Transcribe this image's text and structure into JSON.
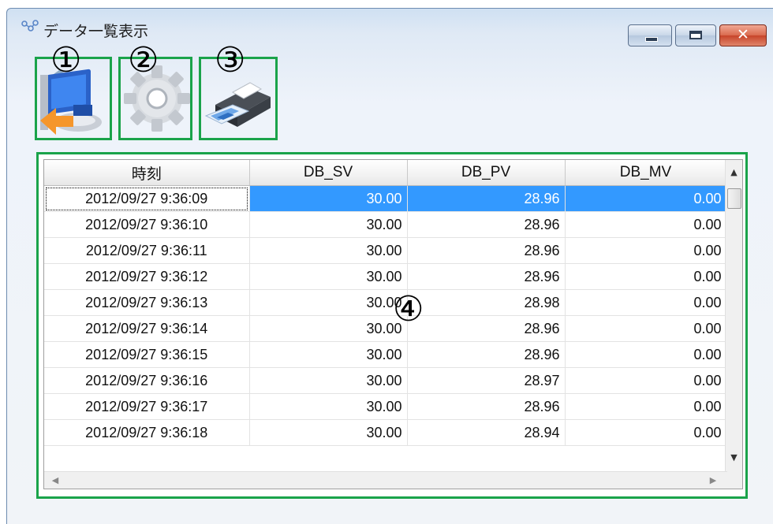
{
  "window": {
    "title": "データ一覧表示",
    "icon": "app-network-icon",
    "buttons": {
      "minimize": "minimize-icon",
      "maximize": "maximize-icon",
      "close": "✕"
    }
  },
  "annotations": [
    "①",
    "②",
    "③",
    "④"
  ],
  "toolbar": [
    {
      "name": "exit-icon"
    },
    {
      "name": "settings-gear-icon"
    },
    {
      "name": "printer-icon"
    }
  ],
  "table": {
    "columns": [
      "時刻",
      "DB_SV",
      "DB_PV",
      "DB_MV"
    ],
    "rows": [
      [
        "2012/09/27 9:36:09",
        "30.00",
        "28.96",
        "0.00"
      ],
      [
        "2012/09/27 9:36:10",
        "30.00",
        "28.96",
        "0.00"
      ],
      [
        "2012/09/27 9:36:11",
        "30.00",
        "28.96",
        "0.00"
      ],
      [
        "2012/09/27 9:36:12",
        "30.00",
        "28.96",
        "0.00"
      ],
      [
        "2012/09/27 9:36:13",
        "30.00",
        "28.98",
        "0.00"
      ],
      [
        "2012/09/27 9:36:14",
        "30.00",
        "28.96",
        "0.00"
      ],
      [
        "2012/09/27 9:36:15",
        "30.00",
        "28.96",
        "0.00"
      ],
      [
        "2012/09/27 9:36:16",
        "30.00",
        "28.97",
        "0.00"
      ],
      [
        "2012/09/27 9:36:17",
        "30.00",
        "28.96",
        "0.00"
      ],
      [
        "2012/09/27 9:36:18",
        "30.00",
        "28.94",
        "0.00"
      ]
    ],
    "selected_row_index": 0
  },
  "colors": {
    "annotation_border": "#1aa34a",
    "selection": "#3399ff"
  }
}
